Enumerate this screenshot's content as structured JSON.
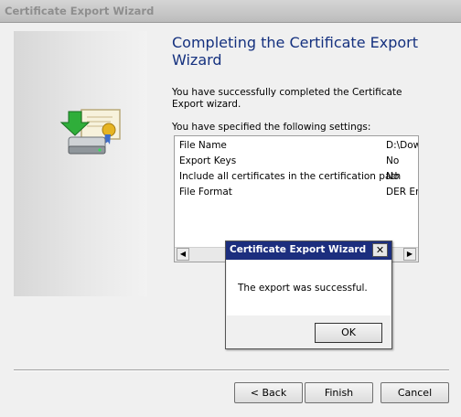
{
  "window": {
    "title": "Certificate Export Wizard"
  },
  "heading": "Completing the Certificate Export Wizard",
  "message": "You have successfully completed the Certificate Export wizard.",
  "settings_label": "You have specified the following settings:",
  "settings": [
    {
      "key": "File Name",
      "value": "D:\\Dow"
    },
    {
      "key": "Export Keys",
      "value": "No"
    },
    {
      "key": "Include all certificates in the certification path",
      "value": "No"
    },
    {
      "key": "File Format",
      "value": "DER En"
    }
  ],
  "buttons": {
    "back": "< Back",
    "finish": "Finish",
    "cancel": "Cancel"
  },
  "dialog": {
    "title": "Certificate Export Wizard",
    "message": "The export was successful.",
    "ok": "OK",
    "close": "✕"
  },
  "colors": {
    "heading": "#15317f",
    "dialog_title_bg": "#1c2e7e"
  }
}
